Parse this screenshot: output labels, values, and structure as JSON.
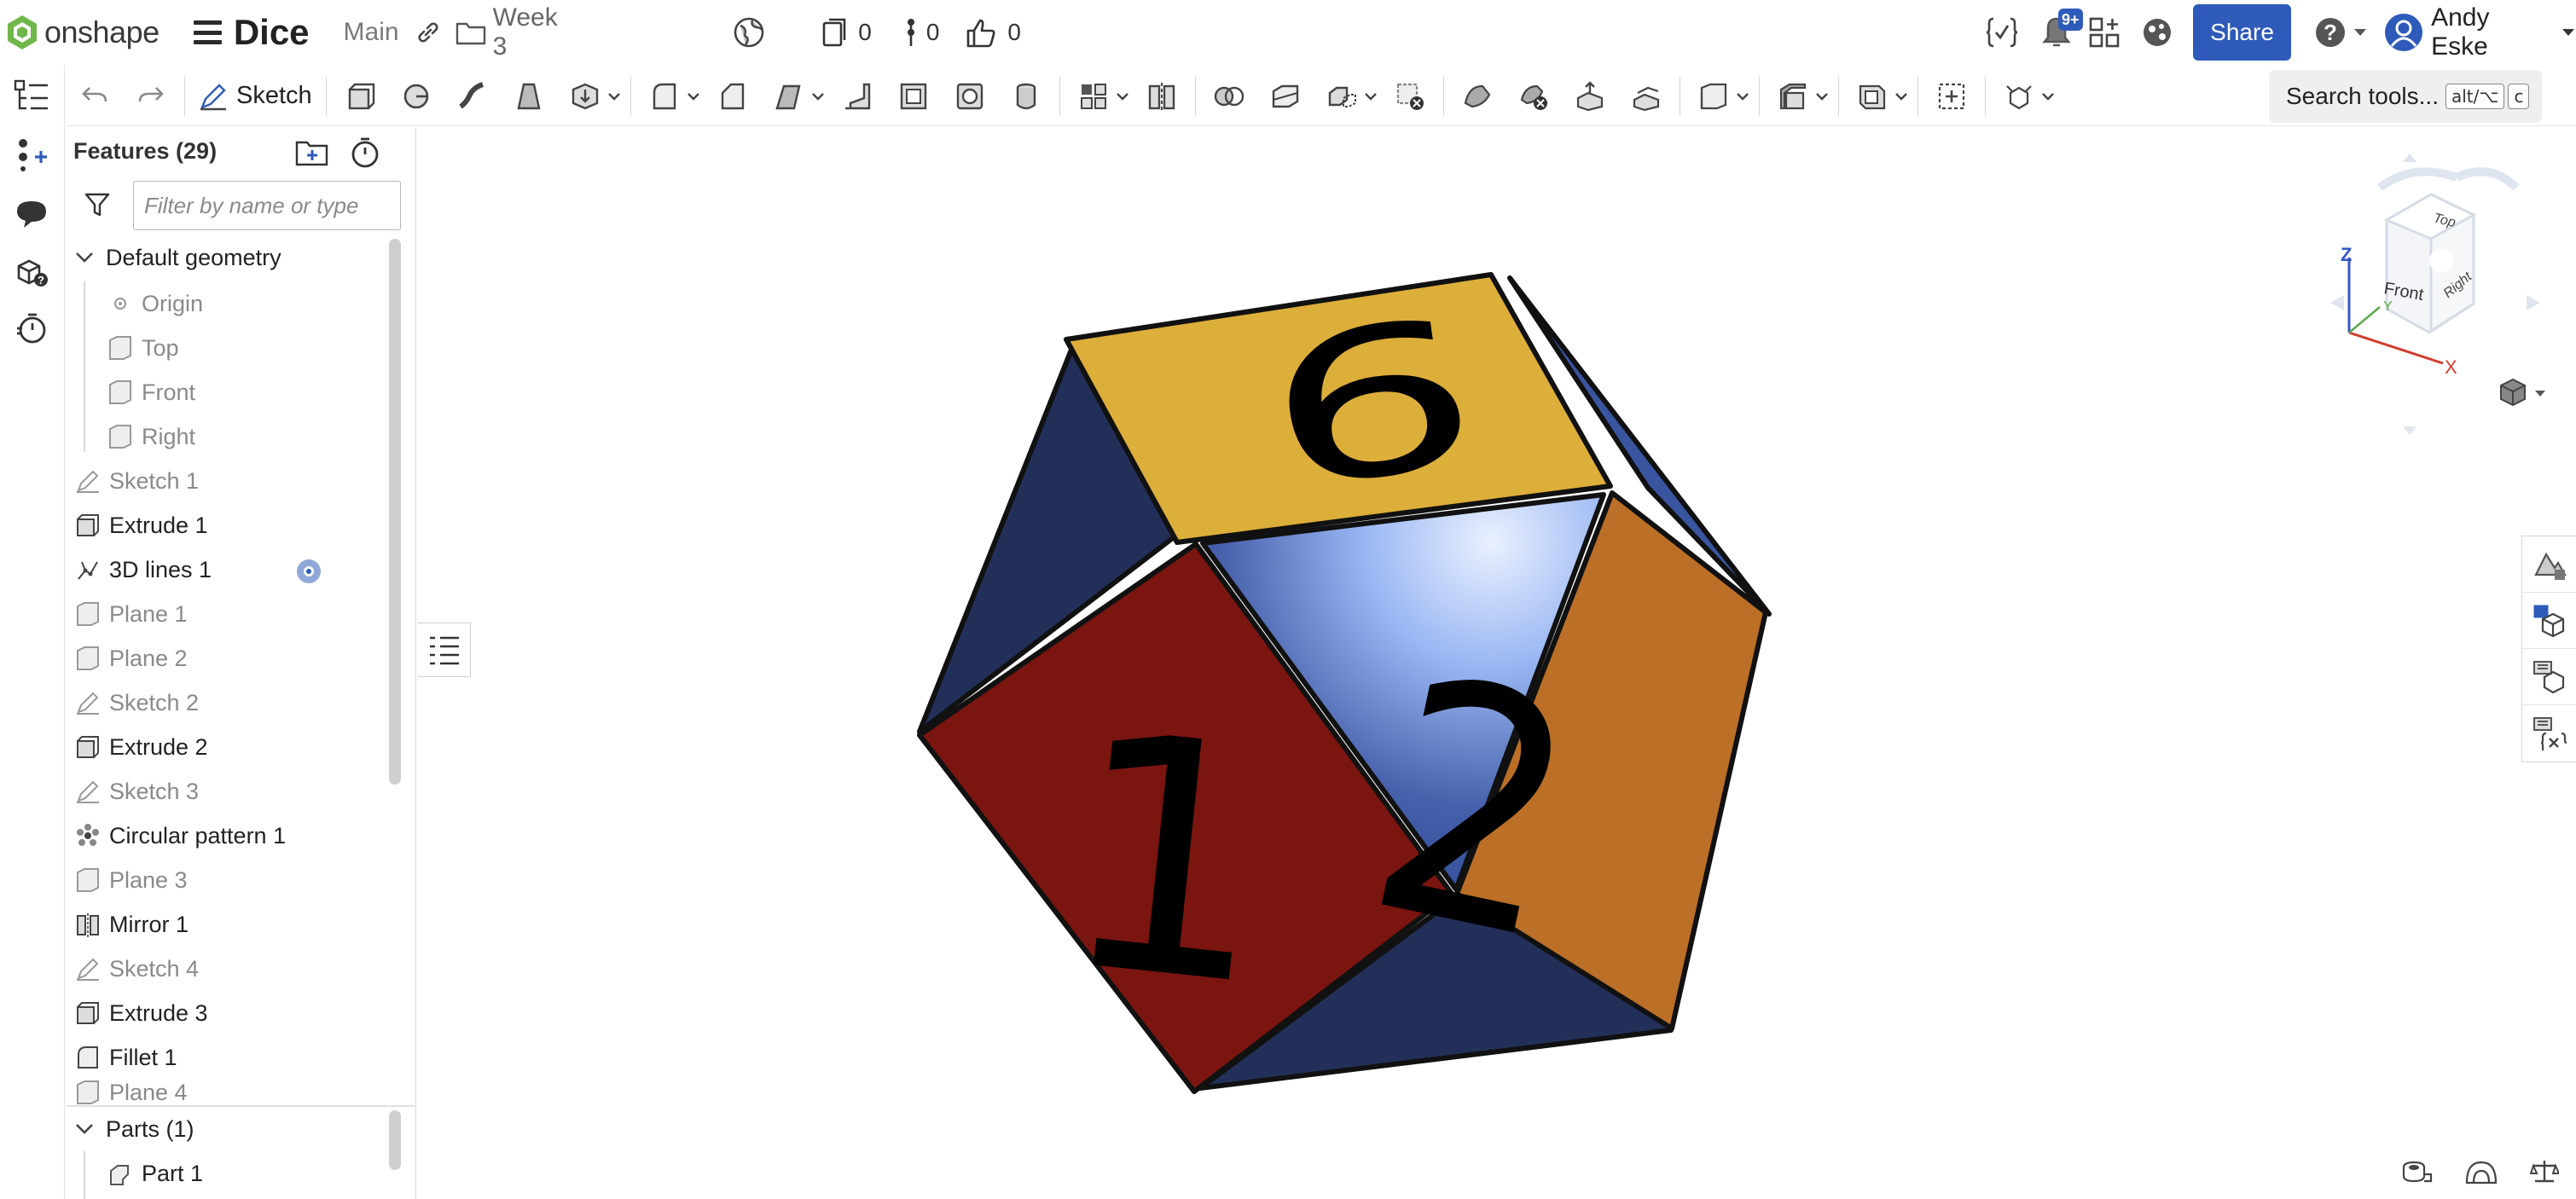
{
  "app": {
    "brand": "onshape",
    "doc_title": "Dice",
    "branch": "Main",
    "folder": "Week 3"
  },
  "header": {
    "versions_count": "0",
    "branches_count": "0",
    "likes_count": "0",
    "notifications_badge": "9+",
    "share_label": "Share",
    "user_name": "Andy Eske"
  },
  "toolbar": {
    "sketch_label": "Sketch",
    "search_label": "Search tools...",
    "search_shortcut_1": "alt/⌥",
    "search_shortcut_2": "c"
  },
  "features": {
    "title": "Features (29)",
    "filter_placeholder": "Filter by name or type",
    "items": [
      {
        "label": "Default geometry",
        "icon": "chevron-down-icon",
        "state": "group"
      },
      {
        "label": "Origin",
        "icon": "origin-icon",
        "state": "dim"
      },
      {
        "label": "Top",
        "icon": "plane-icon",
        "state": "dim"
      },
      {
        "label": "Front",
        "icon": "plane-icon",
        "state": "dim"
      },
      {
        "label": "Right",
        "icon": "plane-icon",
        "state": "dim"
      },
      {
        "label": "Sketch 1",
        "icon": "sketch-icon",
        "state": "dim"
      },
      {
        "label": "Extrude 1",
        "icon": "extrude-icon",
        "state": "on"
      },
      {
        "label": "3D lines 1",
        "icon": "3d-lines-icon",
        "state": "on"
      },
      {
        "label": "Plane 1",
        "icon": "plane-icon",
        "state": "dim"
      },
      {
        "label": "Plane 2",
        "icon": "plane-icon",
        "state": "dim"
      },
      {
        "label": "Sketch 2",
        "icon": "sketch-icon",
        "state": "dim"
      },
      {
        "label": "Extrude 2",
        "icon": "extrude-icon",
        "state": "on"
      },
      {
        "label": "Sketch 3",
        "icon": "sketch-icon",
        "state": "dim"
      },
      {
        "label": "Circular pattern 1",
        "icon": "circular-pattern-icon",
        "state": "on"
      },
      {
        "label": "Plane 3",
        "icon": "plane-icon",
        "state": "dim"
      },
      {
        "label": "Mirror 1",
        "icon": "mirror-icon",
        "state": "on"
      },
      {
        "label": "Sketch 4",
        "icon": "sketch-icon",
        "state": "dim"
      },
      {
        "label": "Extrude 3",
        "icon": "extrude-icon",
        "state": "on"
      },
      {
        "label": "Fillet 1",
        "icon": "fillet-icon",
        "state": "on"
      },
      {
        "label": "Plane 4",
        "icon": "plane-icon",
        "state": "dim"
      }
    ],
    "parts_title": "Parts (1)",
    "parts": [
      {
        "label": "Part 1",
        "icon": "part-icon"
      }
    ]
  },
  "viewcube": {
    "axis_z": "Z",
    "axis_x": "X",
    "axis_y": "Y",
    "face_top": "Top",
    "face_front": "Front",
    "face_right": "Right"
  },
  "model": {
    "face_top_number": "6",
    "face_left_number": "1",
    "face_right_number": "2",
    "colors": {
      "top": "#dcae3a",
      "left": "#7a1510",
      "right": "#bb6f27",
      "dark_blue": "#223059",
      "mid_blue": "#3a55a0",
      "light_blue": "#dfeaff"
    }
  },
  "colors": {
    "accent": "#2e5bba",
    "feature_dim": "#8a8a8a"
  }
}
